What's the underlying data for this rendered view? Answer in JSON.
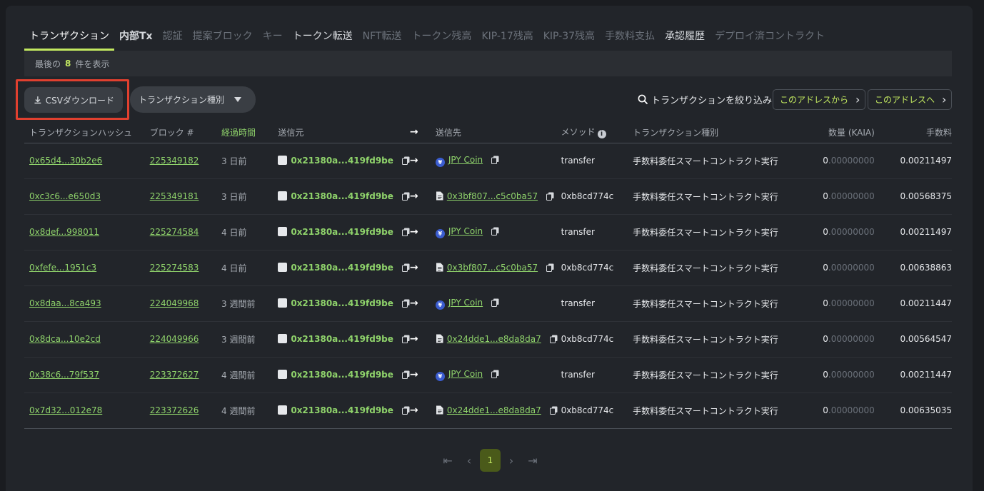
{
  "tabs": [
    {
      "label": "トランザクション",
      "state": "active"
    },
    {
      "label": "内部Tx",
      "state": "light"
    },
    {
      "label": "認証",
      "state": "dim"
    },
    {
      "label": "提案ブロック",
      "state": "dim"
    },
    {
      "label": "キー",
      "state": "dim"
    },
    {
      "label": "トークン転送",
      "state": "light"
    },
    {
      "label": "NFT転送",
      "state": "dim"
    },
    {
      "label": "トークン残高",
      "state": "dim"
    },
    {
      "label": "KIP-17残高",
      "state": "dim"
    },
    {
      "label": "KIP-37残高",
      "state": "dim"
    },
    {
      "label": "手数料支払",
      "state": "dim"
    },
    {
      "label": "承認履歴",
      "state": "light"
    },
    {
      "label": "デプロイ済コントラクト",
      "state": "dim"
    }
  ],
  "info": {
    "prefix": "最後の",
    "count": "8",
    "suffix": "件を表示"
  },
  "toolbar": {
    "csv_label": "CSVダウンロード",
    "type_label": "トランザクション種別",
    "filter_label": "トランザクションを絞り込み",
    "from_label": "このアドレスから",
    "to_label": "このアドレスへ"
  },
  "table": {
    "headers": {
      "hash": "トランザクションハッシュ",
      "block": "ブロック #",
      "age": "経過時間",
      "from": "送信元",
      "arrow": "→",
      "to": "送信先",
      "method": "メソッド",
      "type": "トランザクション種別",
      "amount": "数量 (KAIA)",
      "fee": "手数料"
    },
    "rows": [
      {
        "hash": "0x65d4...30b2e6",
        "block": "225349182",
        "age": "3 日前",
        "from": "0x21380a...419fd9be",
        "to": "JPY Coin",
        "to_kind": "coin",
        "method": "transfer",
        "type": "手数料委任スマートコントラクト実行",
        "amount_int": "0",
        "amount_dec": ".00000000",
        "fee": "0.00211497"
      },
      {
        "hash": "0xc3c6...e650d3",
        "block": "225349181",
        "age": "3 日前",
        "from": "0x21380a...419fd9be",
        "to": "0x3bf807...c5c0ba57",
        "to_kind": "contract",
        "method": "0xb8cd774c",
        "type": "手数料委任スマートコントラクト実行",
        "amount_int": "0",
        "amount_dec": ".00000000",
        "fee": "0.00568375"
      },
      {
        "hash": "0x8def...998011",
        "block": "225274584",
        "age": "4 日前",
        "from": "0x21380a...419fd9be",
        "to": "JPY Coin",
        "to_kind": "coin",
        "method": "transfer",
        "type": "手数料委任スマートコントラクト実行",
        "amount_int": "0",
        "amount_dec": ".00000000",
        "fee": "0.00211497"
      },
      {
        "hash": "0xfefe...1951c3",
        "block": "225274583",
        "age": "4 日前",
        "from": "0x21380a...419fd9be",
        "to": "0x3bf807...c5c0ba57",
        "to_kind": "contract",
        "method": "0xb8cd774c",
        "type": "手数料委任スマートコントラクト実行",
        "amount_int": "0",
        "amount_dec": ".00000000",
        "fee": "0.00638863"
      },
      {
        "hash": "0x8daa...8ca493",
        "block": "224049968",
        "age": "3 週間前",
        "from": "0x21380a...419fd9be",
        "to": "JPY Coin",
        "to_kind": "coin",
        "method": "transfer",
        "type": "手数料委任スマートコントラクト実行",
        "amount_int": "0",
        "amount_dec": ".00000000",
        "fee": "0.00211447"
      },
      {
        "hash": "0x8dca...10e2cd",
        "block": "224049966",
        "age": "3 週間前",
        "from": "0x21380a...419fd9be",
        "to": "0x24dde1...e8da8da7",
        "to_kind": "contract",
        "method": "0xb8cd774c",
        "type": "手数料委任スマートコントラクト実行",
        "amount_int": "0",
        "amount_dec": ".00000000",
        "fee": "0.00564547"
      },
      {
        "hash": "0x38c6...79f537",
        "block": "223372627",
        "age": "4 週間前",
        "from": "0x21380a...419fd9be",
        "to": "JPY Coin",
        "to_kind": "coin",
        "method": "transfer",
        "type": "手数料委任スマートコントラクト実行",
        "amount_int": "0",
        "amount_dec": ".00000000",
        "fee": "0.00211447"
      },
      {
        "hash": "0x7d32...012e78",
        "block": "223372626",
        "age": "4 週間前",
        "from": "0x21380a...419fd9be",
        "to": "0x24dde1...e8da8da7",
        "to_kind": "contract",
        "method": "0xb8cd774c",
        "type": "手数料委任スマートコントラクト実行",
        "amount_int": "0",
        "amount_dec": ".00000000",
        "fee": "0.00635035"
      }
    ]
  },
  "pagination": {
    "current": "1"
  },
  "colors": {
    "accent": "#c3e960",
    "link": "#8fd36b",
    "highlight": "#e1402f",
    "background": "#22252a"
  }
}
